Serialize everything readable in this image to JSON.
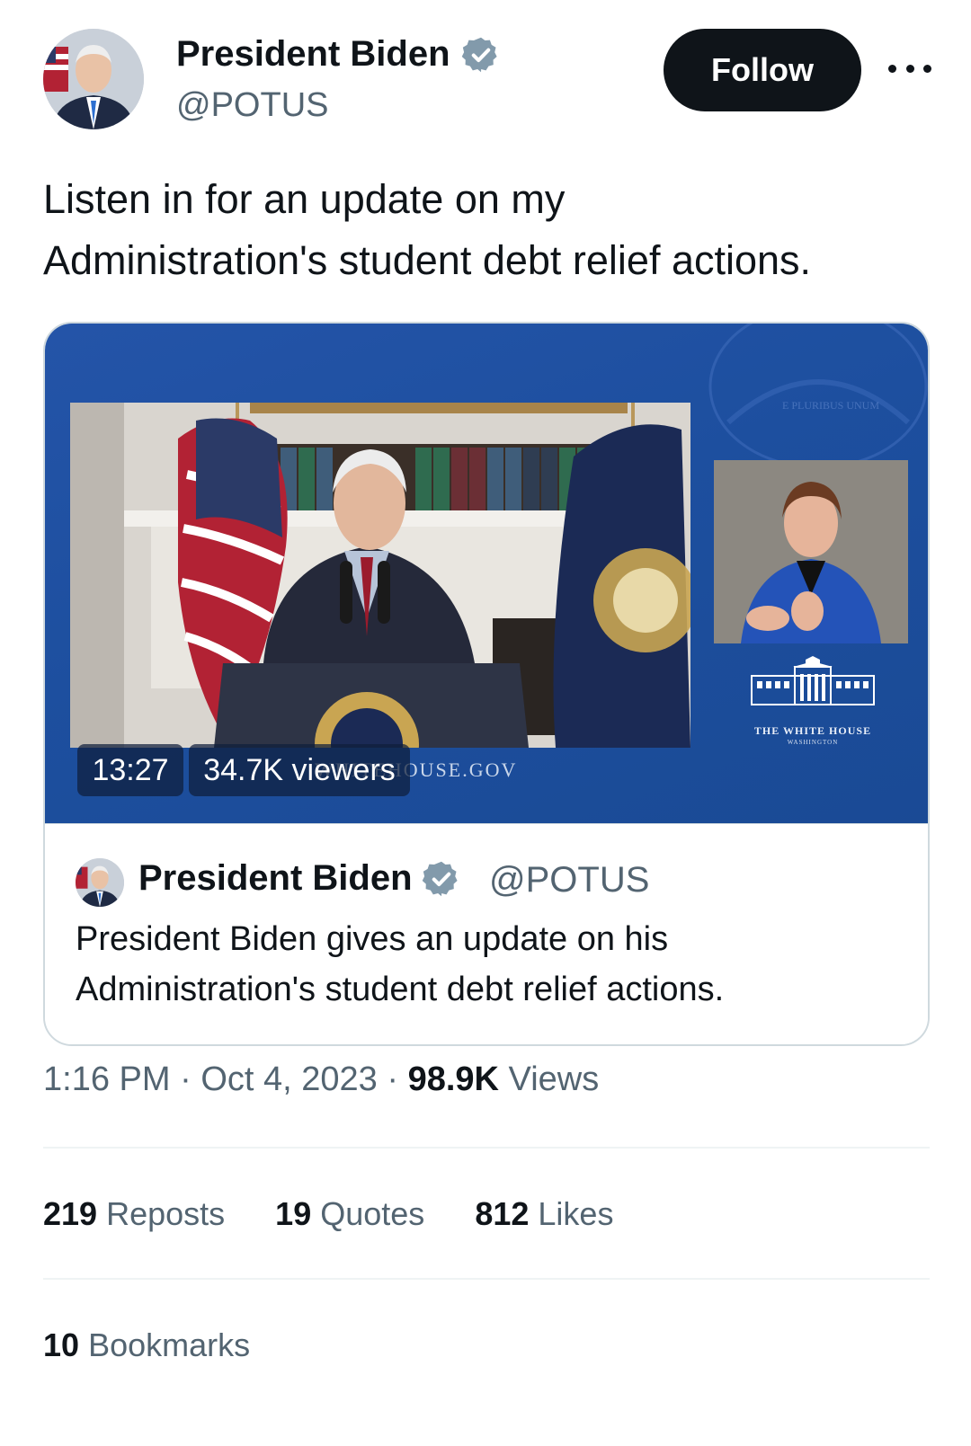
{
  "author": {
    "name": "President Biden",
    "handle": "@POTUS",
    "verified_icon": "verified-badge-icon"
  },
  "follow_button": {
    "label": "Follow"
  },
  "more_menu": {
    "icon": "more-options-icon"
  },
  "tweet": {
    "text": "Listen in for an update on my\nAdministration's student debt relief actions."
  },
  "media": {
    "duration": "13:27",
    "viewers": "34.7K viewers",
    "overlay_site": "WHITEHOUSE.GOV",
    "broadcaster_title": "THE WHITE HOUSE",
    "broadcaster_sub": "WASHINGTON"
  },
  "quoted": {
    "name": "President Biden",
    "handle": "@POTUS",
    "text": "President Biden gives an update on his\nAdministration's student debt relief actions."
  },
  "meta": {
    "time": "1:16 PM",
    "date": "Oct 4, 2023",
    "views_count": "98.9K",
    "views_label": "Views"
  },
  "stats": {
    "reposts_count": "219",
    "reposts_label": "Reposts",
    "quotes_count": "19",
    "quotes_label": "Quotes",
    "likes_count": "812",
    "likes_label": "Likes",
    "bookmarks_count": "10",
    "bookmarks_label": "Bookmarks"
  },
  "colors": {
    "text": "#0f1419",
    "secondary": "#536471",
    "verified": "#829aab",
    "media_blue": "#1d4f9f"
  }
}
